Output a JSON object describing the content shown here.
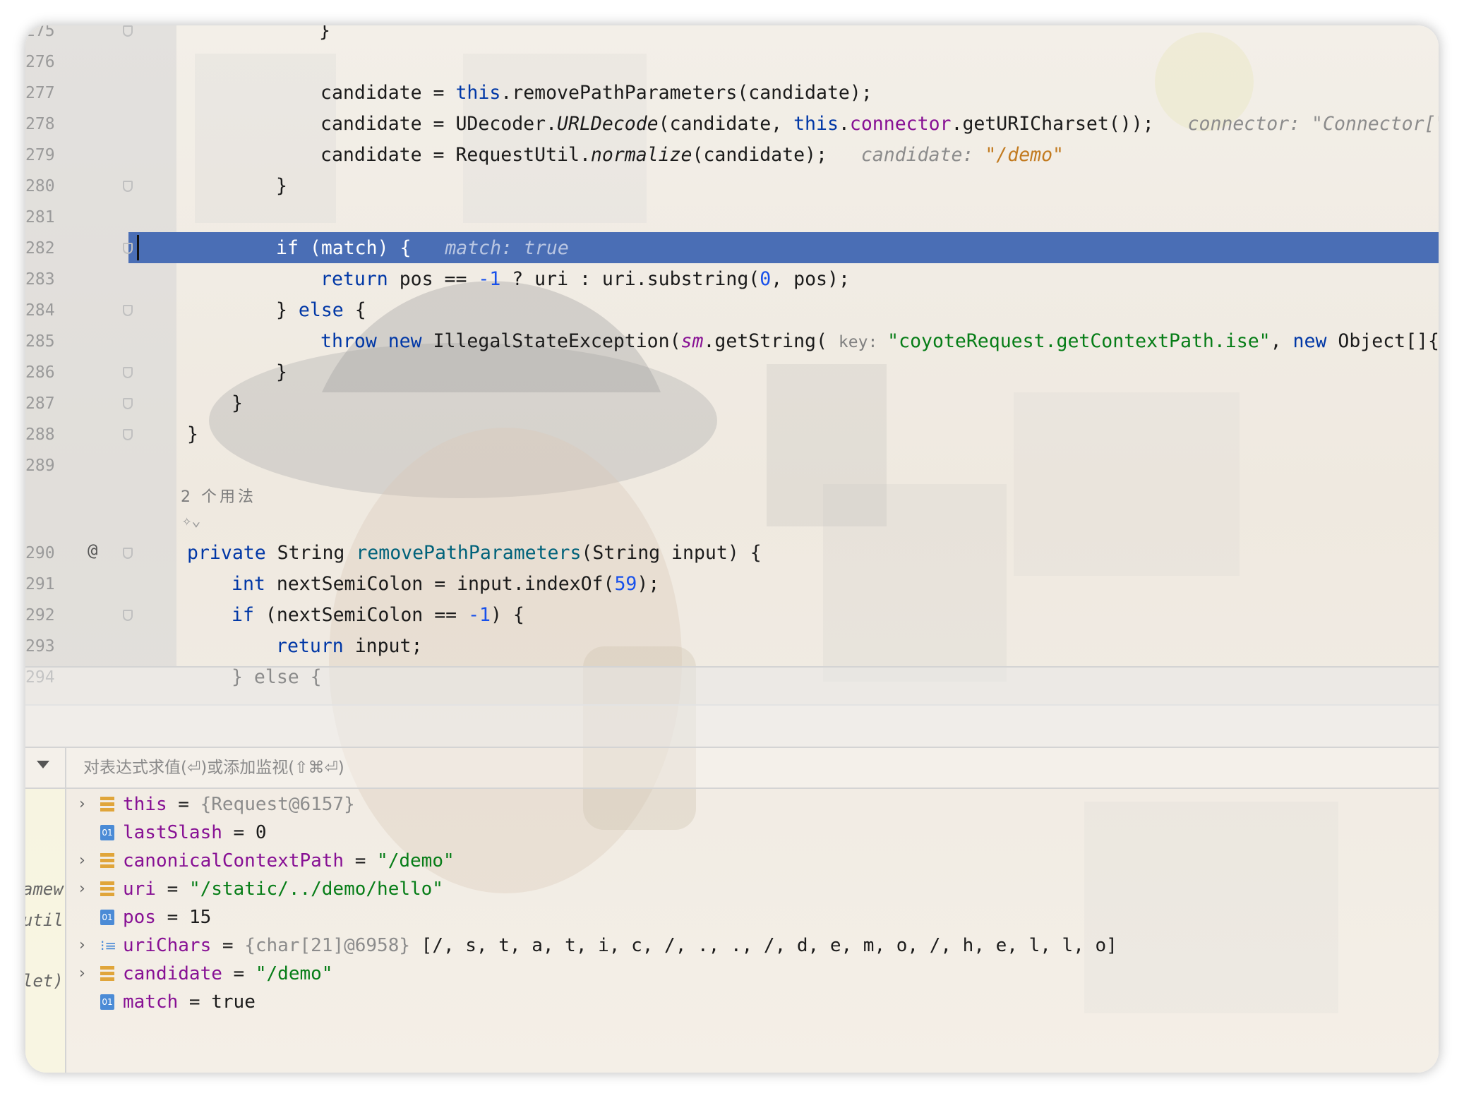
{
  "editor": {
    "lines": [
      {
        "n": "275",
        "tokens": [
          {
            "t": "}"
          }
        ]
      },
      {
        "n": "276",
        "tokens": []
      },
      {
        "n": "277",
        "tokens": [
          {
            "t": "candidate = "
          },
          {
            "t": "this",
            "c": "kw"
          },
          {
            "t": ".removePathParameters(candidate);"
          }
        ]
      },
      {
        "n": "278",
        "tokens": [
          {
            "t": "candidate = UDecoder."
          },
          {
            "t": "URLDecode",
            "c": "it"
          },
          {
            "t": "(candidate, "
          },
          {
            "t": "this",
            "c": "kw"
          },
          {
            "t": "."
          },
          {
            "t": "connector",
            "c": "field"
          },
          {
            "t": ".getURICharset());"
          },
          {
            "t": "   connector: \"Connector[\"htt",
            "c": "hint"
          }
        ]
      },
      {
        "n": "279",
        "tokens": [
          {
            "t": "candidate = RequestUtil."
          },
          {
            "t": "normalize",
            "c": "it"
          },
          {
            "t": "(candidate);"
          },
          {
            "t": "   candidate: ",
            "c": "hint"
          },
          {
            "t": "\"/demo\"",
            "c": "hintstr"
          }
        ]
      },
      {
        "n": "280",
        "tokens": [
          {
            "t": "}"
          }
        ]
      },
      {
        "n": "281",
        "tokens": []
      },
      {
        "n": "282",
        "tokens": [
          {
            "t": "if (match) {"
          },
          {
            "t": "   match: true",
            "c": "hint"
          }
        ]
      },
      {
        "n": "283",
        "tokens": [
          {
            "t": "return",
            "c": "kw"
          },
          {
            "t": " pos == "
          },
          {
            "t": "-1",
            "c": "num"
          },
          {
            "t": " ? uri : uri.substring("
          },
          {
            "t": "0",
            "c": "num"
          },
          {
            "t": ", pos);"
          }
        ]
      },
      {
        "n": "284",
        "tokens": [
          {
            "t": "} "
          },
          {
            "t": "else",
            "c": "kw"
          },
          {
            "t": " {"
          }
        ]
      },
      {
        "n": "285",
        "tokens": [
          {
            "t": "throw new",
            "c": "kw"
          },
          {
            "t": " IllegalStateException("
          },
          {
            "t": "sm",
            "c": "field it"
          },
          {
            "t": ".getString( "
          },
          {
            "t": "key: ",
            "c": "param"
          },
          {
            "t": "\"coyoteRequest.getContextPath.ise\"",
            "c": "str"
          },
          {
            "t": ", "
          },
          {
            "t": "new",
            "c": "kw"
          },
          {
            "t": " Object[]{car"
          }
        ]
      },
      {
        "n": "286",
        "tokens": [
          {
            "t": "}"
          }
        ]
      },
      {
        "n": "287",
        "tokens": [
          {
            "t": "}"
          }
        ]
      },
      {
        "n": "288",
        "tokens": [
          {
            "t": "}"
          }
        ]
      },
      {
        "n": "289",
        "tokens": []
      },
      {
        "n": "290",
        "tokens": [
          {
            "t": "private",
            "c": "kw"
          },
          {
            "t": " String "
          },
          {
            "t": "removePathParameters",
            "c": "fn"
          },
          {
            "t": "(String input) {"
          }
        ]
      },
      {
        "n": "291",
        "tokens": [
          {
            "t": "int",
            "c": "kw"
          },
          {
            "t": " nextSemiColon = input.indexOf("
          },
          {
            "t": "59",
            "c": "num"
          },
          {
            "t": ");"
          }
        ]
      },
      {
        "n": "292",
        "tokens": [
          {
            "t": "if",
            "c": "kw"
          },
          {
            "t": " (nextSemiColon == "
          },
          {
            "t": "-1",
            "c": "num"
          },
          {
            "t": ") {"
          }
        ]
      },
      {
        "n": "293",
        "tokens": [
          {
            "t": "return",
            "c": "kw"
          },
          {
            "t": " input;"
          }
        ]
      },
      {
        "n": "294",
        "tokens": [
          {
            "t": "} else {"
          }
        ]
      }
    ],
    "usages_label": "2 个用法",
    "at_icon": "@"
  },
  "debugger": {
    "eval_placeholder": "对表达式求值(⏎)或添加监视(⇧⌘⏎)",
    "left_strip": [
      "amew",
      "util",
      "let)"
    ],
    "variables": [
      {
        "expandable": true,
        "icon": "object",
        "name": "this",
        "eq": " = ",
        "value": "{Request@6157}",
        "vclass": "vgrey"
      },
      {
        "expandable": false,
        "icon": "primitive",
        "name": "lastSlash",
        "eq": " = ",
        "value": "0",
        "vclass": ""
      },
      {
        "expandable": true,
        "icon": "object",
        "name": "canonicalContextPath",
        "eq": " = ",
        "value": "\"/demo\"",
        "vclass": "vstr"
      },
      {
        "expandable": true,
        "icon": "object",
        "name": "uri",
        "eq": " = ",
        "value": "\"/static/../demo/hello\"",
        "vclass": "vstr"
      },
      {
        "expandable": false,
        "icon": "primitive",
        "name": "pos",
        "eq": " = ",
        "value": "15",
        "vclass": ""
      },
      {
        "expandable": true,
        "icon": "array",
        "name": "uriChars",
        "eq": " = ",
        "value": "{char[21]@6958}",
        "vclass": "vgrey",
        "extra": " [/, s, t, a, t, i, c, /, ., ., /, d, e, m, o, /, h, e, l, l, o]"
      },
      {
        "expandable": true,
        "icon": "object",
        "name": "candidate",
        "eq": " = ",
        "value": "\"/demo\"",
        "vclass": "vstr"
      },
      {
        "expandable": false,
        "icon": "primitive",
        "name": "match",
        "eq": " = ",
        "value": "true",
        "vclass": ""
      }
    ]
  }
}
